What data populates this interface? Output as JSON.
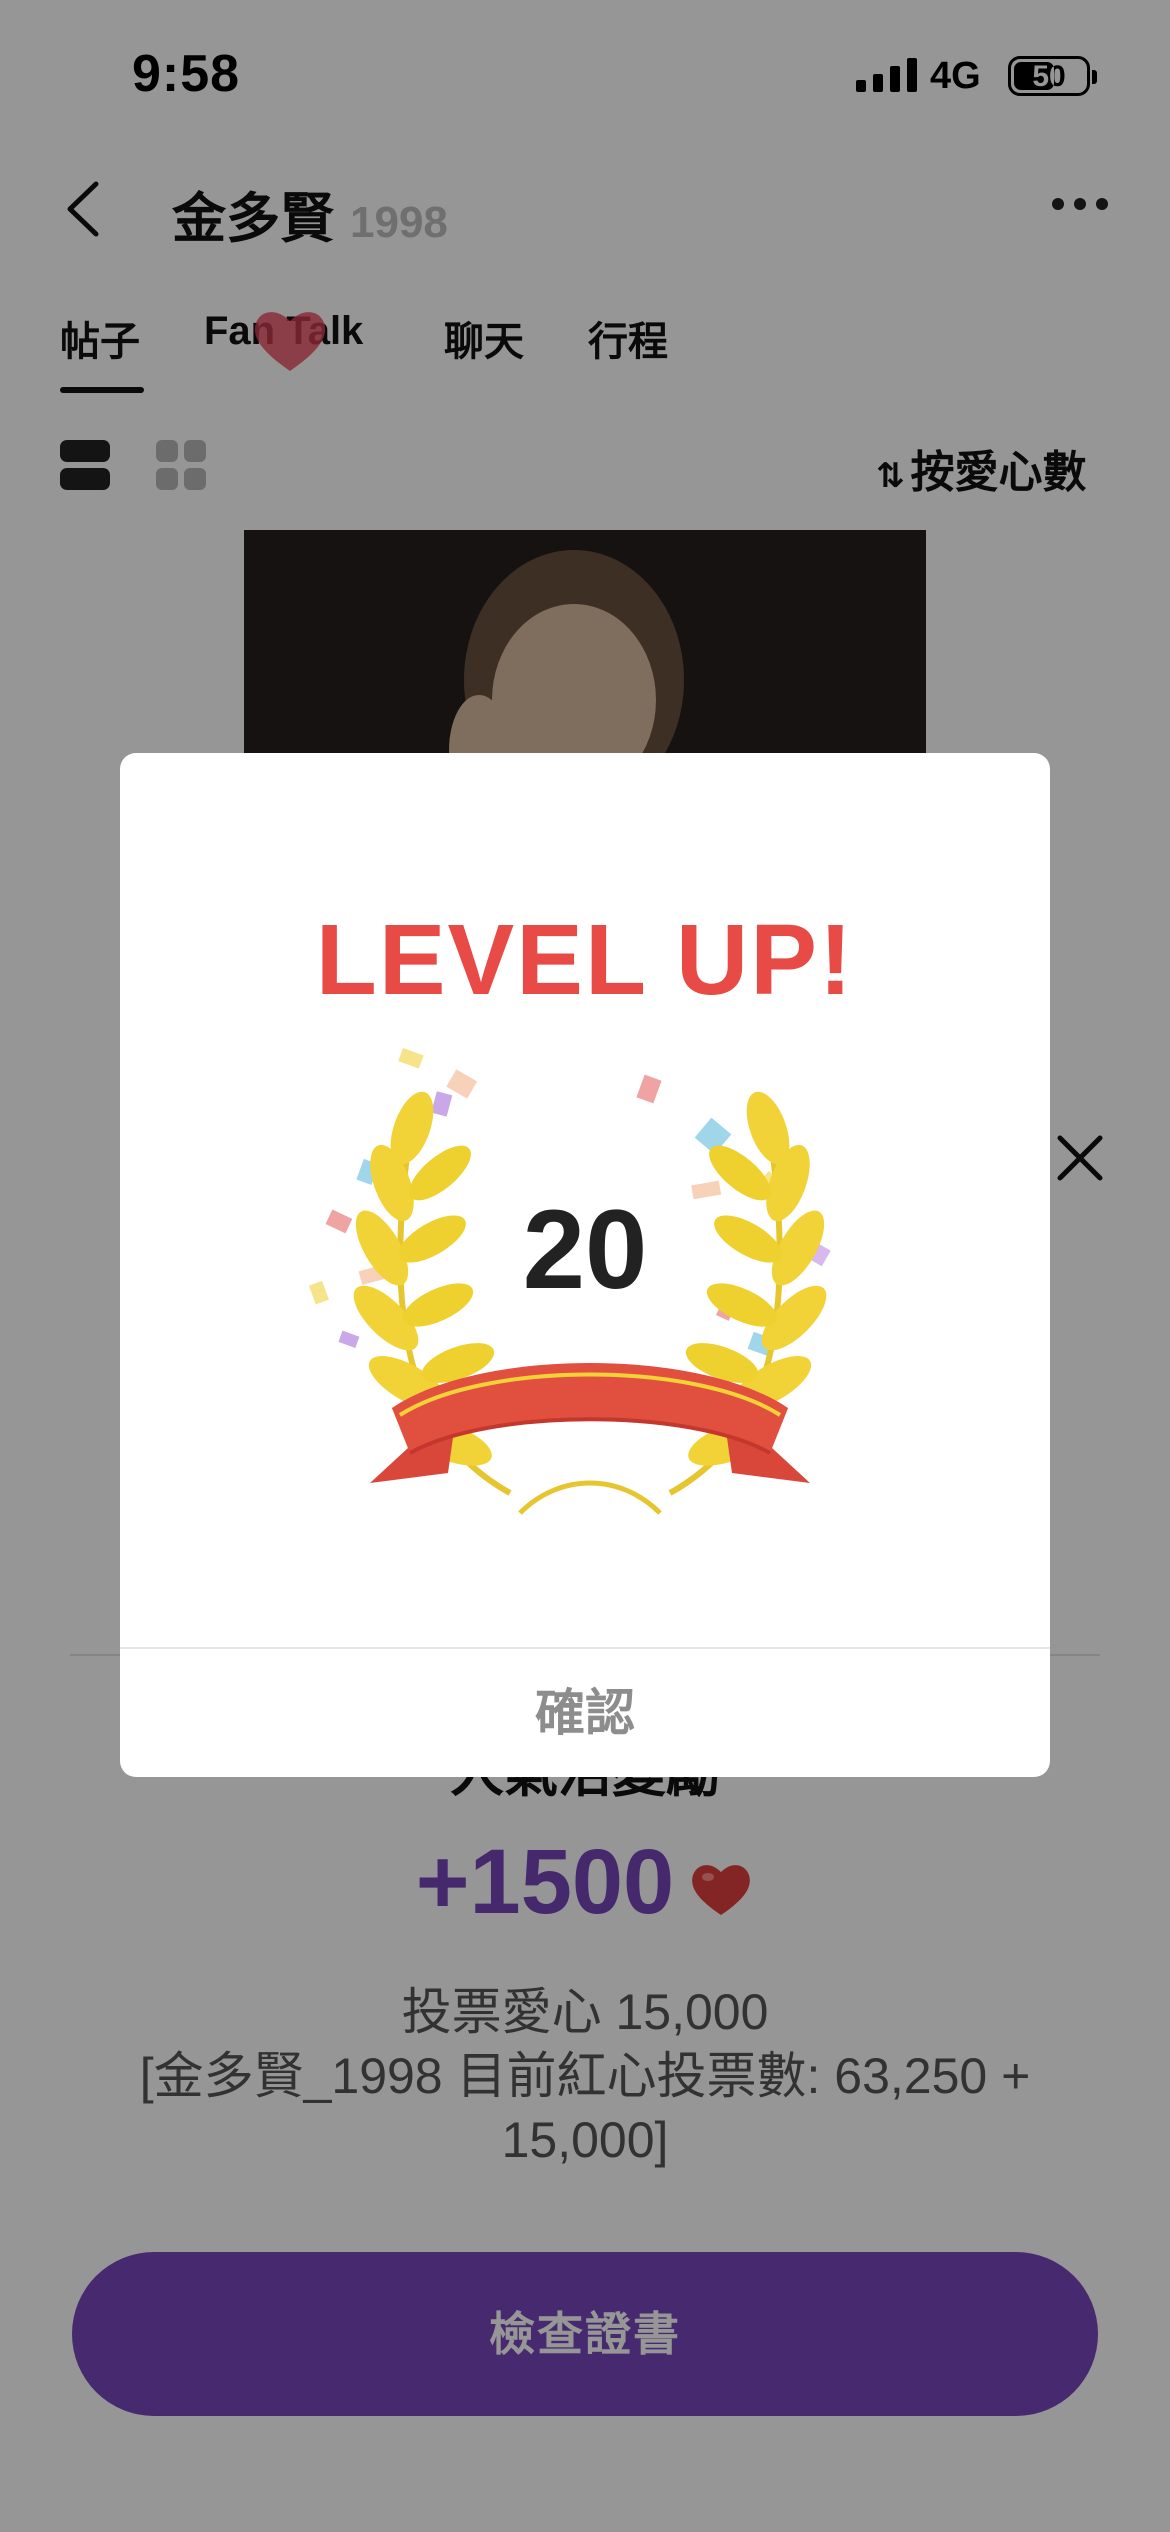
{
  "status_bar": {
    "time": "9:58",
    "network": "4G",
    "battery": "50"
  },
  "header": {
    "title": "金多賢",
    "title_suffix": "1998"
  },
  "tabs": [
    {
      "label": "帖子"
    },
    {
      "label": "Fan Talk"
    },
    {
      "label": "聊天"
    },
    {
      "label": "行程"
    }
  ],
  "sort": {
    "label": "按愛心數"
  },
  "sheet": {
    "reward_title": "人氣活變勵",
    "reward_amount": "+1500",
    "vote_line1": "投票愛心 15,000",
    "vote_line2": "[金多賢_1998 目前紅心投票數: 63,250 + 15,000]",
    "cert_button": "檢查證書"
  },
  "modal": {
    "title": "LEVEL UP!",
    "level": "20",
    "confirm": "確認"
  },
  "colors": {
    "accent": "#7a46bf",
    "levelup_red": "#e84a46",
    "laurel": "#f2d337",
    "ribbon": "#e1503e"
  }
}
